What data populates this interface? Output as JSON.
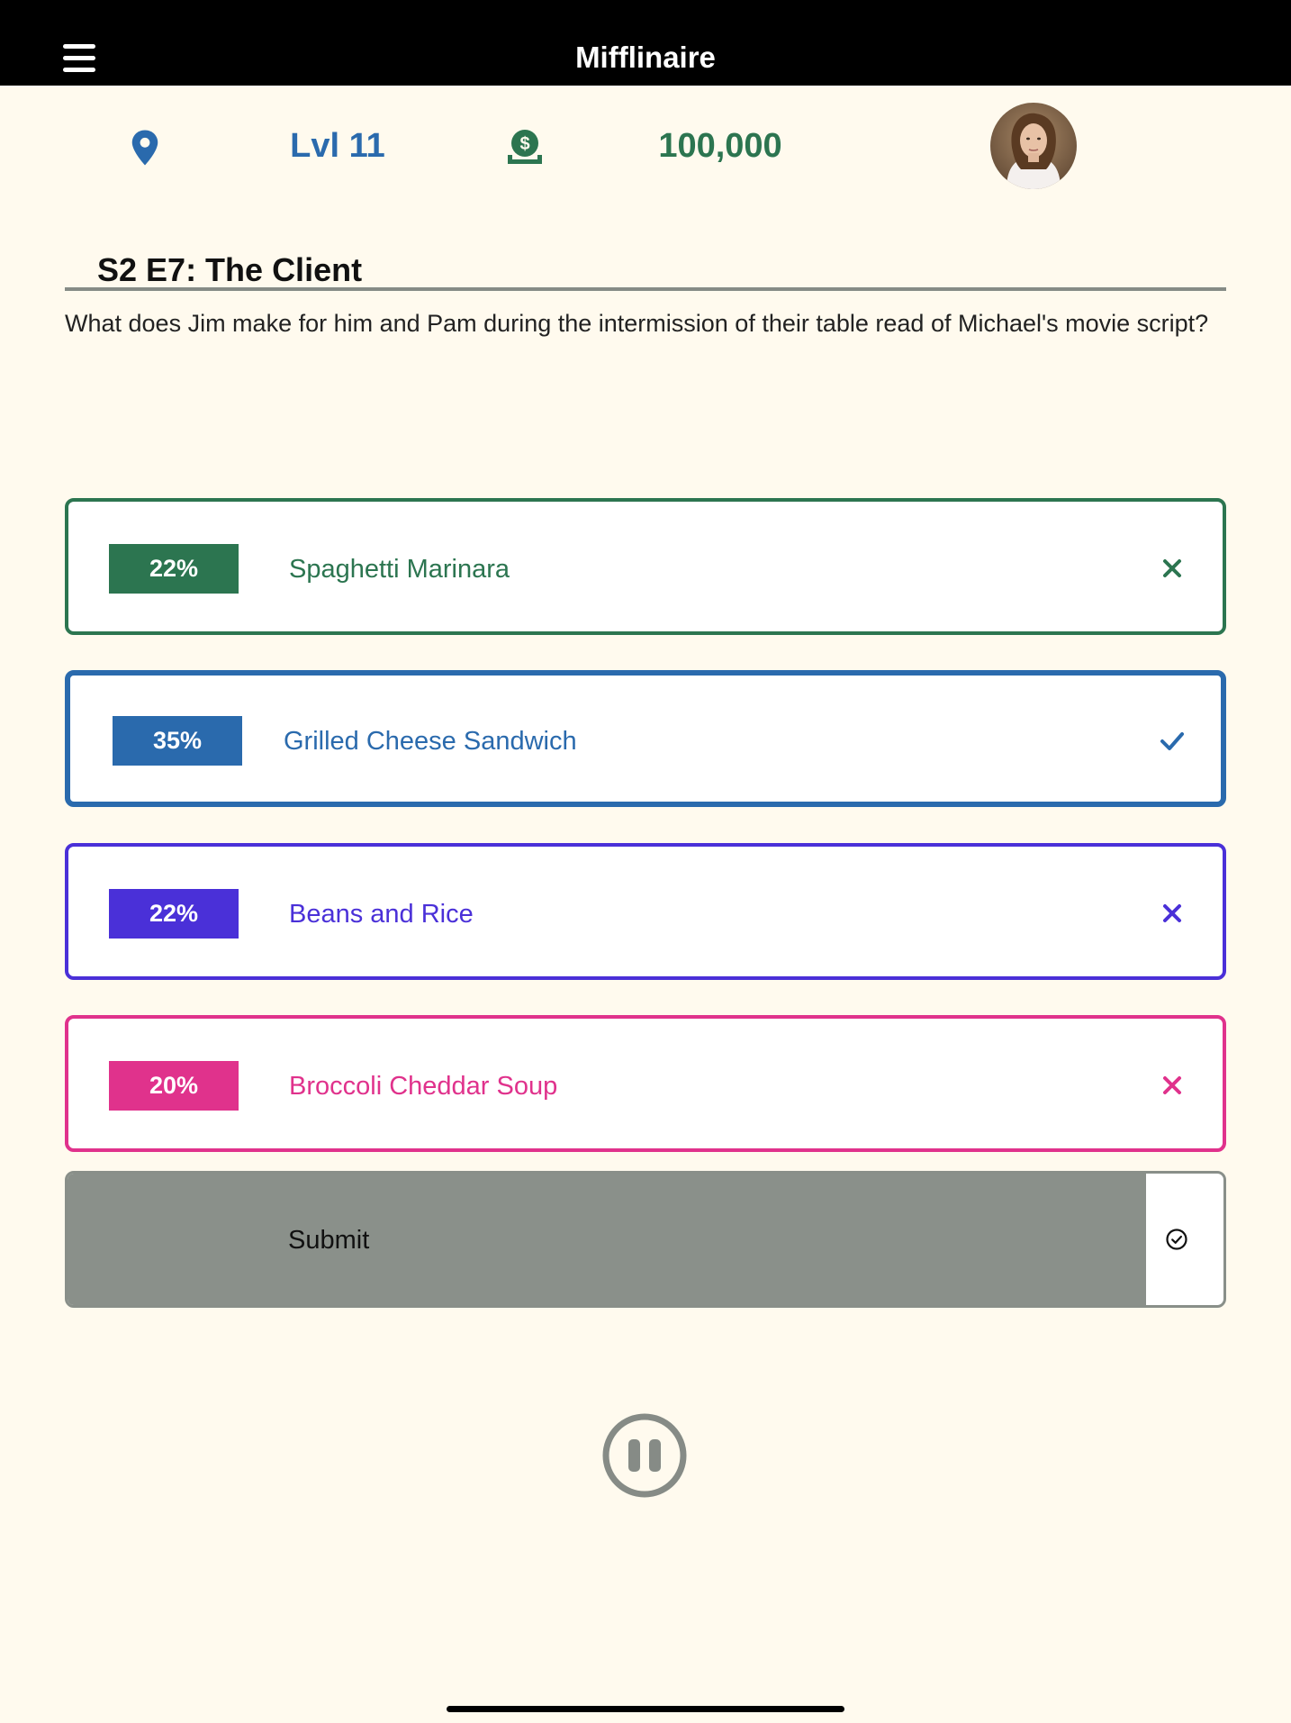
{
  "app": {
    "title": "Mifflinaire"
  },
  "icons": {
    "menu": "hamburger-menu-icon",
    "location": "map-pin-icon",
    "money": "money-hand-dollar-icon",
    "correct": "check-icon",
    "wrong": "x-icon",
    "submit": "check-circle-icon",
    "pause": "pause-circle-icon"
  },
  "stats": {
    "level": "Lvl 11",
    "coins": "100,000"
  },
  "colors": {
    "background": "#fffaee",
    "appbar": "#000000",
    "blue": "#2a6aad",
    "green": "#2c7550",
    "purple": "#4a30d8",
    "pink": "#e0328c",
    "gray": "#8a908a"
  },
  "question": {
    "episode": "S2 E7: The Client",
    "text": "What does Jim make for him and Pam during the intermission of their table read of Michael's movie script?"
  },
  "answers": [
    {
      "percent": "22%",
      "label": "Spaghetti Marinara",
      "mark": "x-icon",
      "color": "#2c7550",
      "selected": false
    },
    {
      "percent": "35%",
      "label": "Grilled Cheese Sandwich",
      "mark": "check-icon",
      "color": "#2a6aad",
      "selected": true
    },
    {
      "percent": "22%",
      "label": "Beans and Rice",
      "mark": "x-icon",
      "color": "#4a30d8",
      "selected": false
    },
    {
      "percent": "20%",
      "label": "Broccoli Cheddar Soup",
      "mark": "x-icon",
      "color": "#e0328c",
      "selected": false
    }
  ],
  "submit": {
    "label": "Submit",
    "progress": 0.933
  }
}
